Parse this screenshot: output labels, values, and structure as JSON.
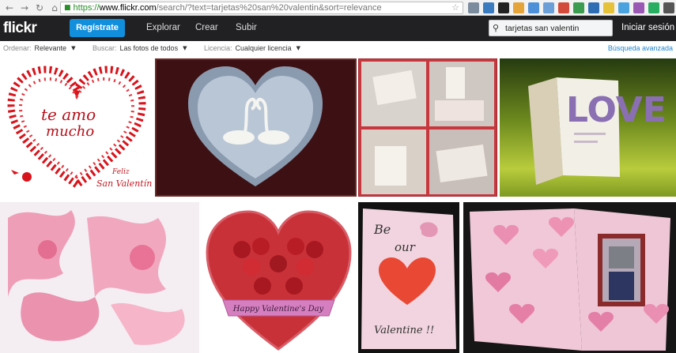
{
  "browser": {
    "url_scheme": "https://",
    "url_host": "www.flickr.com",
    "url_path": "/search/?text=tarjetas%20san%20valentin&sort=relevance"
  },
  "header": {
    "logo": "flickr",
    "signup_label": "Regístrate",
    "nav": [
      "Explorar",
      "Crear",
      "Subir"
    ],
    "search_value": "tarjetas san valentin",
    "login_label": "Iniciar sesión"
  },
  "filters": {
    "sort_label": "Ordenar:",
    "sort_value": "Relevante",
    "search_label": "Buscar:",
    "search_value": "Las fotos de todos",
    "license_label": "Licencia:",
    "license_value": "Cualquier licencia",
    "advanced": "Búsqueda avanzada"
  },
  "photos": {
    "p1": {
      "line1": "te amo",
      "line2": "mucho",
      "line3": "Feliz",
      "line4": "San Valentín"
    },
    "p4": {
      "letters": "LOVE"
    },
    "p6": {
      "banner": "Happy Valentine's Day"
    },
    "p7": {
      "line1": "Be",
      "line2": "our",
      "line3": "Valentine !!"
    }
  },
  "colors": {
    "header_bg": "#212124",
    "signup_blue": "#128fdc",
    "link_blue": "#1f84ce"
  }
}
